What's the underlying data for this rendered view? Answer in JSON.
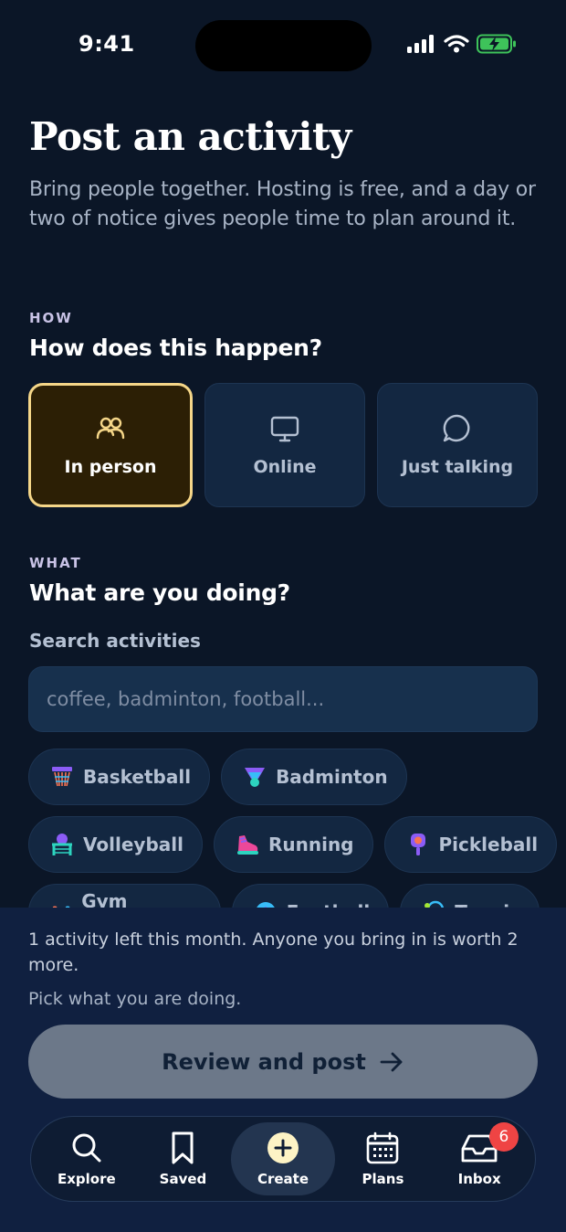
{
  "status_bar": {
    "time": "9:41"
  },
  "header": {
    "title": "Post an activity",
    "subtitle": "Bring people together. Hosting is free, and a day or two of notice gives people time to plan around it."
  },
  "how_section": {
    "eyebrow": "HOW",
    "heading": "How does this happen?",
    "options": [
      {
        "label": "In person",
        "icon": "people-icon",
        "selected": true
      },
      {
        "label": "Online",
        "icon": "monitor-icon",
        "selected": false
      },
      {
        "label": "Just talking",
        "icon": "chat-bubble-icon",
        "selected": false
      }
    ]
  },
  "what_section": {
    "eyebrow": "WHAT",
    "heading": "What are you doing?",
    "search_label": "Search activities",
    "search_placeholder": "coffee, badminton, football...",
    "activities": [
      {
        "label": "Basketball",
        "icon": "basketball-hoop-icon"
      },
      {
        "label": "Badminton",
        "icon": "shuttlecock-icon"
      },
      {
        "label": "Volleyball",
        "icon": "volleyball-icon"
      },
      {
        "label": "Running",
        "icon": "running-shoe-icon"
      },
      {
        "label": "Pickleball",
        "icon": "pickleball-paddle-icon"
      },
      {
        "label": "Gym session",
        "icon": "dumbbell-icon"
      },
      {
        "label": "Football",
        "icon": "football-icon"
      },
      {
        "label": "Tennis",
        "icon": "tennis-racket-icon"
      }
    ]
  },
  "footer": {
    "info": "1 activity left this month. Anyone you bring in is worth 2 more.",
    "hint": "Pick what you are doing.",
    "primary_button": "Review and post"
  },
  "tab_bar": {
    "tabs": [
      {
        "label": "Explore",
        "icon": "search-icon",
        "active": false
      },
      {
        "label": "Saved",
        "icon": "bookmark-icon",
        "active": false
      },
      {
        "label": "Create",
        "icon": "plus-circle-icon",
        "active": true
      },
      {
        "label": "Plans",
        "icon": "calendar-icon",
        "active": false
      },
      {
        "label": "Inbox",
        "icon": "inbox-icon",
        "active": false,
        "badge": "6"
      }
    ]
  },
  "colors": {
    "background": "#0b1627",
    "selected_accent": "#f5d688",
    "badge": "#ef4444",
    "disabled_button": "#6c7889"
  }
}
